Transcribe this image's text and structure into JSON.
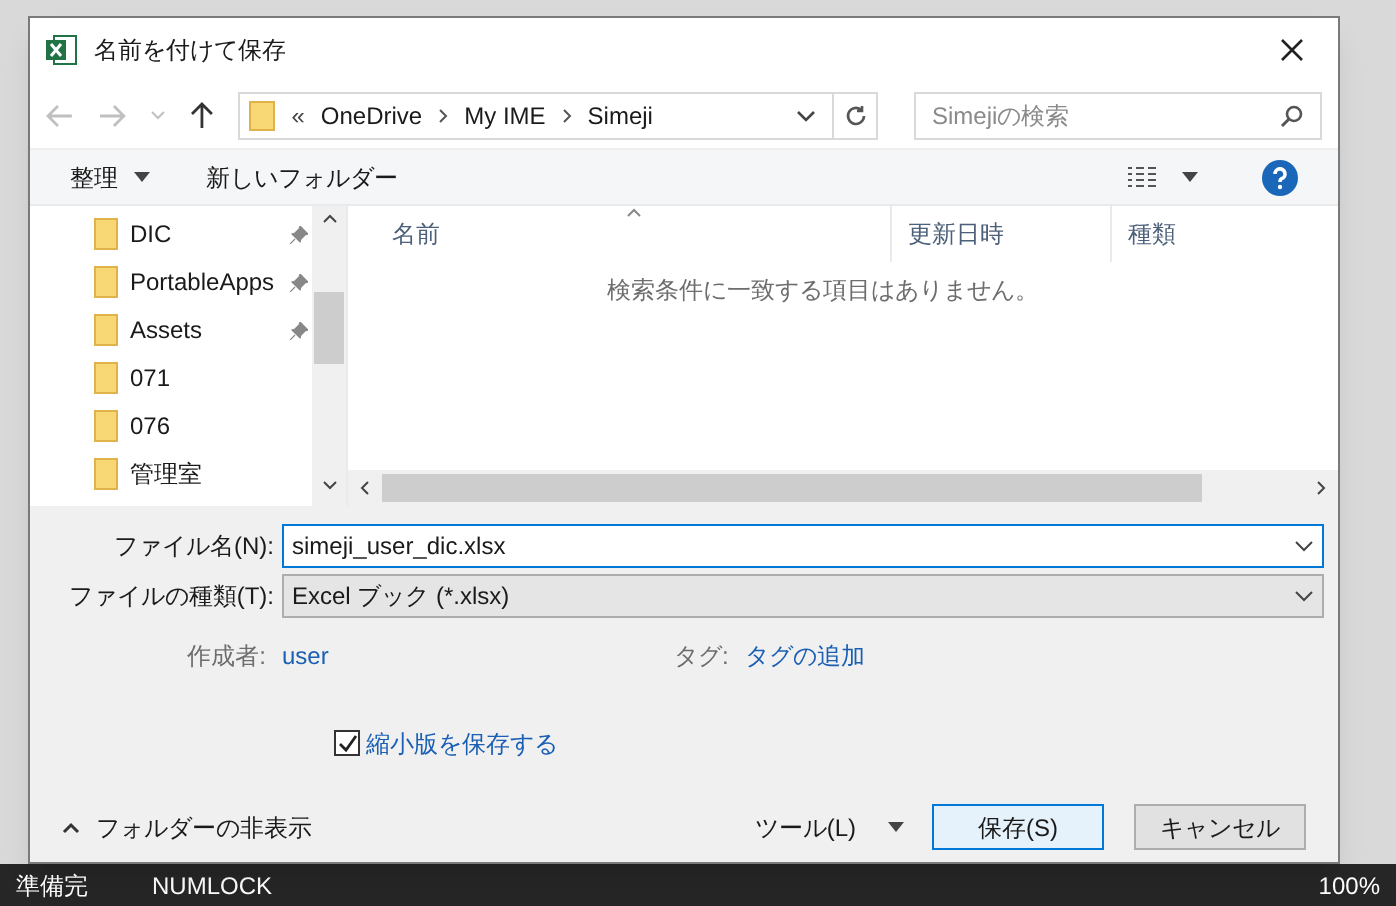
{
  "window": {
    "title": "名前を付けて保存"
  },
  "address": {
    "overflow": "«",
    "path": [
      "OneDrive",
      "My IME",
      "Simeji"
    ],
    "search_placeholder": "Simejiの検索"
  },
  "toolbar": {
    "organize": "整理",
    "new_folder": "新しいフォルダー"
  },
  "nav_items": [
    {
      "label": "DIC",
      "pinned": true
    },
    {
      "label": "PortableApps",
      "pinned": true
    },
    {
      "label": "Assets",
      "pinned": true
    },
    {
      "label": "071",
      "pinned": false
    },
    {
      "label": "076",
      "pinned": false
    },
    {
      "label": "管理室",
      "pinned": false
    }
  ],
  "columns": [
    "名前",
    "更新日時",
    "種類"
  ],
  "empty_message": "検索条件に一致する項目はありません。",
  "filename": {
    "label": "ファイル名(N):",
    "value": "simeji_user_dic.xlsx"
  },
  "filetype": {
    "label": "ファイルの種類(T):",
    "value": "Excel ブック (*.xlsx)"
  },
  "meta": [
    {
      "label": "作成者:",
      "value": "user"
    },
    {
      "label": "タグ:",
      "value": "タグの追加"
    }
  ],
  "thumbnail": {
    "label": "縮小版を保存する",
    "checked": true
  },
  "hide_folders": "フォルダーの非表示",
  "tools": "ツール(L)",
  "buttons": [
    {
      "label": "保存(S)",
      "kind": "primary"
    },
    {
      "label": "キャンセル",
      "kind": "normal"
    }
  ],
  "status_bar": {
    "ready": "準備完",
    "numlock": "NUMLOCK",
    "zoom": "100%"
  }
}
